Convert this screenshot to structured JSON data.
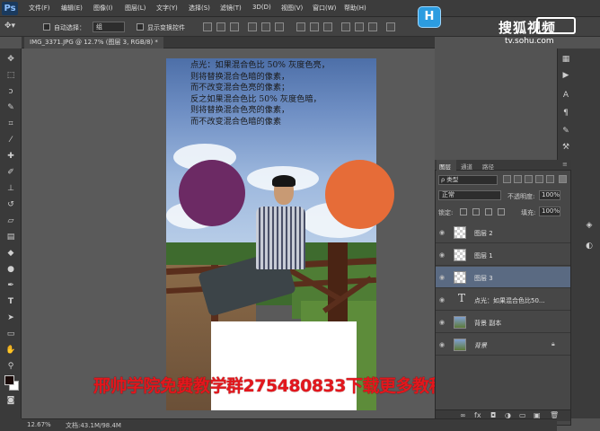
{
  "app": {
    "logo": "Ps"
  },
  "menu": [
    "文件(F)",
    "编辑(E)",
    "图像(I)",
    "图层(L)",
    "文字(Y)",
    "选择(S)",
    "滤镜(T)",
    "3D(D)",
    "视图(V)",
    "窗口(W)",
    "帮助(H)"
  ],
  "options": {
    "move_tool_icon": "move-icon",
    "auto_select_label": "自动选择：",
    "auto_select_value": "组",
    "show_transform_label": "显示变换控件"
  },
  "overlay": {
    "badge": "H",
    "sohu_text": "搜狐视频",
    "sohu_url": "tv.sohu.com"
  },
  "document": {
    "tab_title": "IMG_3371.JPG @ 12.7% (图层 3, RGB/8) *",
    "zoom": "12.67%",
    "doc_size": "文档:43.1M/98.4M"
  },
  "canvas": {
    "text_lines": [
      "点光：如果混合色比 50% 灰度色亮，",
      "则将替换混合色暗的像素，",
      "而不改变混合色亮的像素；",
      "反之如果混合色比 50% 灰度色暗，",
      "则将替换混合色亮的像素，",
      "而不改变混合色暗的像素"
    ],
    "watermark": "邢帅学院免费教学群275480833下载更多教程和素材听免费公开课",
    "circle_left_color": "#6c2a64",
    "circle_right_color": "#e66c38"
  },
  "layers_panel": {
    "tabs": [
      "图层",
      "通道",
      "路径"
    ],
    "filter_value": "ρ 类型",
    "blend_mode": "正常",
    "opacity_label": "不透明度:",
    "opacity_value": "100%",
    "lock_label": "锁定:",
    "fill_label": "填充:",
    "fill_value": "100%",
    "layers": [
      {
        "name": "图层 2",
        "thumb": "transparent",
        "selected": false
      },
      {
        "name": "图层 1",
        "thumb": "transparent",
        "selected": false
      },
      {
        "name": "图层 3",
        "thumb": "transparent",
        "selected": true
      },
      {
        "name": "点光：如果混合色比50...",
        "thumb": "text",
        "selected": false
      },
      {
        "name": "背景 副本",
        "thumb": "photo",
        "selected": false
      },
      {
        "name": "背景",
        "thumb": "photo",
        "selected": false
      }
    ]
  }
}
